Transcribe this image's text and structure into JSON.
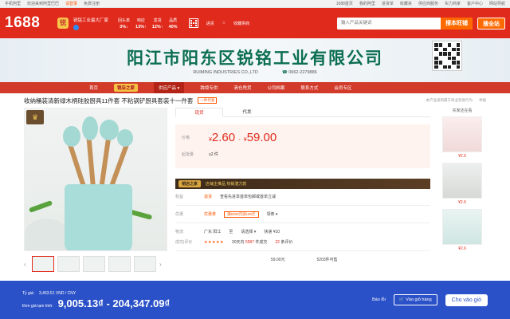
{
  "topbar": {
    "items_left": [
      "手机阿里",
      "欢迎来到阿里巴巴",
      "请登录",
      "免费注册"
    ],
    "items_right": [
      "1688首页",
      "我的阿里",
      "进货单",
      "收藏夹",
      "供应商服务",
      "实力商家",
      "客户中心",
      "网站导航"
    ]
  },
  "header": {
    "logo": "1688",
    "shop_badge": "锐",
    "shop_name": "锐铭工业最大厂家",
    "metrics": [
      {
        "label": "回头率",
        "value": "3%↓"
      },
      {
        "label": "响应",
        "value": "13%↑"
      },
      {
        "label": "发货",
        "value": "12%↑"
      },
      {
        "label": "品质",
        "value": "40%"
      }
    ],
    "icon_labels": [
      "进货",
      "收藏供商"
    ],
    "search_placeholder": "输入产品关键词",
    "search_button": "搜本旺铺",
    "search_all_button": "搜全站"
  },
  "banner": {
    "company_cn": "阳江市阳东区锐铭工业有限公司",
    "company_en": "RUIMING INDUSTRIES CO.,LTD",
    "phone": "0662-2279886"
  },
  "nav": {
    "items": [
      "首页",
      "销店之家",
      "供应产品 ▾",
      "跨境专供",
      "清仓甩货",
      "公司档案",
      "联系方式",
      "会员专区"
    ]
  },
  "product": {
    "title": "收纳桶装清新绿木柄硅胶厨具11件套 不粘锅铲厨具套装十一件套",
    "tag": "一件代发",
    "right_links": [
      "本产品采购属于商业贸易行为",
      "举报"
    ]
  },
  "tabs": [
    "现货",
    "代发"
  ],
  "price": {
    "label": "价格",
    "currency": "¥",
    "low": "2.60",
    "high": "59.00",
    "sep": "-",
    "moq_label": "起批量",
    "moq_value": "≥2 件"
  },
  "shop_strip": {
    "badge": "销店之家",
    "text": "店铺主推品  热销潜力款"
  },
  "rows": {
    "rights_label": "权益",
    "rights_tag": "退货",
    "rights_text": "查看先进享首单包邮或首单立减",
    "discount_label": "优惠",
    "coupon_label": "优惠券",
    "coupon_value": "满5000元减100元",
    "coupon_more": "领券 ▾",
    "ship_label": "物流",
    "ship_from": "广东 阳江",
    "ship_to_label": "至",
    "ship_to": "请选择 ▾",
    "ship_fee": "快递 ¥10",
    "eval_label": "成交|评价",
    "stars": "★★★★★",
    "sold_prefix": "30天内",
    "sold_count": "5587",
    "sold_suffix": "件成交",
    "reviews": "22",
    "reviews_suffix": "条评价",
    "spec1_price": "59.00元",
    "spec1_stock": "5203件可售"
  },
  "side": {
    "header": "买家还在看",
    "prices": [
      "¥2.6",
      "¥2.6",
      "¥2.6"
    ]
  },
  "bottom_bar": {
    "rate_label": "Tỷ giá:",
    "rate_value": "3,463.51 VND / CNY",
    "est_label": "Đơn giá tạm tính:",
    "est_value": "9,005.13₫ - 204,347.09₫",
    "report": "Báo lỗi",
    "add_cart": "Vào giỏ hàng",
    "cta": "Cho vào giỏ"
  },
  "colors": {
    "header_red": "#e02a1c",
    "bottom_blue": "#2b51c8",
    "company_green": "#0b6e52"
  }
}
